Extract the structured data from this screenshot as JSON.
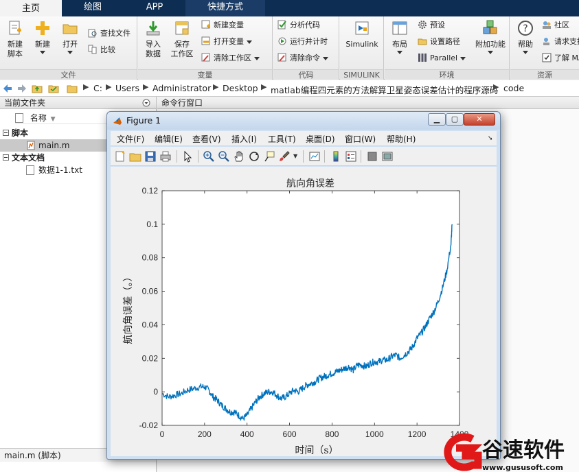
{
  "tabs": [
    "主页",
    "绘图",
    "APP",
    "快捷方式"
  ],
  "ribbon": {
    "file": {
      "label": "文件",
      "new_script": [
        "新建",
        "脚本"
      ],
      "new": "新建",
      "open": "打开",
      "find_files": "查找文件",
      "compare": "比较"
    },
    "variable": {
      "label": "变量",
      "import": [
        "导入",
        "数据"
      ],
      "save_ws": [
        "保存",
        "工作区"
      ],
      "new_var": "新建变量",
      "open_var": "打开变量",
      "clear_ws": "清除工作区"
    },
    "code": {
      "label": "代码",
      "analyze": "分析代码",
      "run_time": "运行并计时",
      "clear_cmds": "清除命令"
    },
    "simulink": {
      "label": "SIMULINK",
      "btn": "Simulink"
    },
    "env": {
      "label": "环境",
      "layout": "布局",
      "prefs": "预设",
      "set_path": "设置路径",
      "parallel": "Parallel",
      "addons": "附加功能"
    },
    "resources": {
      "label": "资源",
      "help": "帮助",
      "community": "社区",
      "request": "请求支持",
      "learn": "了解 MATLAB"
    }
  },
  "address": [
    "C:",
    "Users",
    "Administrator",
    "Desktop",
    "matlab编程四元素的方法解算卫星姿态误差估计的程序源码",
    "code"
  ],
  "left": {
    "header": "当前文件夹",
    "col_name": "名称",
    "group_script": "脚本",
    "file_main": "main.m",
    "group_text": "文本文档",
    "file_data": "数据1-1.txt",
    "details": "main.m  (脚本)"
  },
  "cmd": {
    "header": "命令行窗口"
  },
  "figure": {
    "title": "Figure 1",
    "menus": [
      "文件(F)",
      "编辑(E)",
      "查看(V)",
      "插入(I)",
      "工具(T)",
      "桌面(D)",
      "窗口(W)",
      "帮助(H)"
    ]
  },
  "watermark": {
    "brand": "谷速软件",
    "url": "www.gususoft.com"
  },
  "colors": {
    "tabbar": "#0e2d52",
    "line": "#0072bd",
    "plot_bg": "#ffffff",
    "figure_bg": "#f0f0f0"
  },
  "chart_data": {
    "type": "line",
    "title": "航向角误差",
    "xlabel": "时间（s）",
    "ylabel": "航向角误差（。）",
    "xlim": [
      0,
      1400
    ],
    "ylim": [
      -0.02,
      0.12
    ],
    "xticks": [
      0,
      200,
      400,
      600,
      800,
      1000,
      1200,
      1400
    ],
    "yticks": [
      -0.02,
      0,
      0.02,
      0.04,
      0.06,
      0.08,
      0.1,
      0.12
    ],
    "xtick_labels": [
      "0",
      "200",
      "400",
      "600",
      "800",
      "1000",
      "1200",
      "1400"
    ],
    "ytick_labels": [
      "-0.02",
      "0",
      "0.02",
      "0.04",
      "0.06",
      "0.08",
      "0.1",
      "0.12"
    ],
    "grid": false,
    "series": [
      {
        "x": [
          0,
          30,
          60,
          90,
          120,
          150,
          180,
          200,
          220,
          240,
          260,
          280,
          300,
          320,
          340,
          360,
          380,
          400,
          420,
          440,
          460,
          480,
          500,
          520,
          540,
          560,
          580,
          600,
          620,
          640,
          660,
          680,
          700,
          720,
          740,
          760,
          780,
          800,
          820,
          840,
          860,
          880,
          900,
          920,
          940,
          960,
          980,
          1000,
          1020,
          1040,
          1060,
          1080,
          1100,
          1120,
          1140,
          1160,
          1180,
          1200,
          1220,
          1240,
          1260,
          1280,
          1300,
          1320,
          1340,
          1360,
          1365
        ],
        "y": [
          -0.001,
          -0.003,
          -0.002,
          -0.001,
          0.001,
          0.002,
          0.003,
          0.003,
          0.001,
          -0.003,
          -0.005,
          -0.008,
          -0.01,
          -0.012,
          -0.012,
          -0.014,
          -0.016,
          -0.014,
          -0.01,
          -0.006,
          -0.003,
          -0.001,
          0.0,
          0.0,
          -0.002,
          -0.004,
          -0.003,
          -0.001,
          0.001,
          0.0,
          0.002,
          0.004,
          0.005,
          0.006,
          0.008,
          0.009,
          0.01,
          0.011,
          0.012,
          0.013,
          0.014,
          0.015,
          0.013,
          0.016,
          0.016,
          0.015,
          0.017,
          0.018,
          0.018,
          0.019,
          0.019,
          0.021,
          0.022,
          0.02,
          0.022,
          0.024,
          0.027,
          0.032,
          0.035,
          0.039,
          0.044,
          0.048,
          0.054,
          0.062,
          0.072,
          0.088,
          0.1
        ]
      }
    ]
  }
}
